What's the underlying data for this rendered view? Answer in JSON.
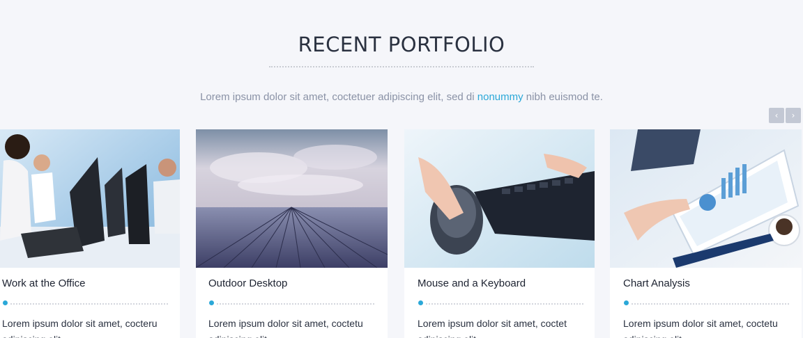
{
  "section": {
    "title": "RECENT PORTFOLIO",
    "subtitle_before": "Lorem ipsum dolor sit amet, coctetuer adipiscing elit, sed di ",
    "subtitle_highlight": "nonummy",
    "subtitle_after": " nibh euismod te."
  },
  "nav": {
    "prev_icon": "chevron-left-icon",
    "next_icon": "chevron-right-icon",
    "prev_glyph": "‹",
    "next_glyph": "›"
  },
  "colors": {
    "accent": "#2ba8d8",
    "background": "#f5f6fa",
    "title": "#2a3140"
  },
  "portfolio": [
    {
      "title": "Work at the Office",
      "text": "Lorem ipsum dolor sit amet, cocteru adipiscing elit"
    },
    {
      "title": "Outdoor Desktop",
      "text": "Lorem ipsum dolor sit amet, coctetu adipiscing elit"
    },
    {
      "title": "Mouse and a Keyboard",
      "text": "Lorem ipsum dolor sit amet, coctet adipiscing elit"
    },
    {
      "title": "Chart Analysis",
      "text": "Lorem ipsum dolor sit amet, coctetu adipiscing elit"
    }
  ]
}
